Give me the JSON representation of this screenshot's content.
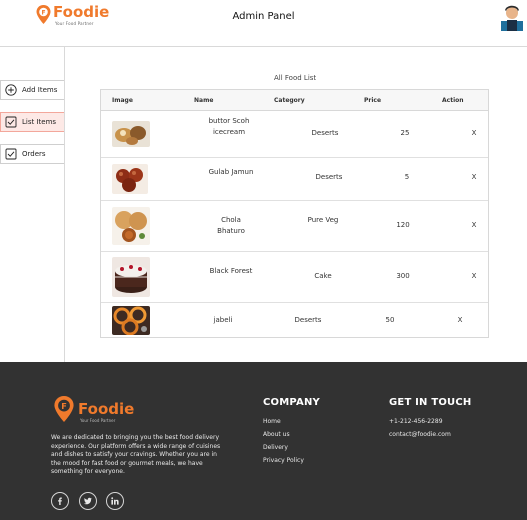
{
  "header": {
    "brand": "Foodie",
    "tagline": "Your Food Partner",
    "title": "Admin Panel"
  },
  "sidebar": {
    "items": [
      {
        "label": "Add Items",
        "icon": "plus-circle-icon",
        "active": false
      },
      {
        "label": "List Items",
        "icon": "checkbox-icon",
        "active": true
      },
      {
        "label": "Orders",
        "icon": "checkbox-icon",
        "active": false
      }
    ]
  },
  "food_list": {
    "title": "All Food List",
    "columns": [
      "Image",
      "Name",
      "Category",
      "Price",
      "Action"
    ],
    "rows": [
      {
        "name": "buttor Scoh icecream",
        "category": "Deserts",
        "price": "25",
        "action": "X"
      },
      {
        "name": "Gulab Jamun",
        "category": "Deserts",
        "price": "5",
        "action": "X"
      },
      {
        "name": "Chola Bhaturo",
        "category": "Pure Veg",
        "price": "120",
        "action": "X"
      },
      {
        "name": "Black Forest",
        "category": "Cake",
        "price": "300",
        "action": "X"
      },
      {
        "name": "jabeli",
        "category": "Deserts",
        "price": "50",
        "action": "X"
      }
    ]
  },
  "footer": {
    "brand": "Foodie",
    "tagline": "Your Food Partner",
    "description": "We are dedicated to bringing you the best food delivery experience. Our platform offers a wide range of cuisines and dishes to satisfy your cravings. Whether you are in the mood for fast food or gourmet meals, we have something for everyone.",
    "company_heading": "COMPANY",
    "company_links": [
      "Home",
      "About us",
      "Delivery",
      "Privacy Policy"
    ],
    "contact_heading": "GET IN TOUCH",
    "phone": "+1-212-456-2289",
    "email": "contact@foodie.com",
    "social": [
      "facebook-icon",
      "twitter-icon",
      "linkedin-icon"
    ]
  },
  "colors": {
    "brand_orange": "#f07a2c",
    "active_bg": "#fde9e6",
    "footer_bg": "#323232"
  }
}
